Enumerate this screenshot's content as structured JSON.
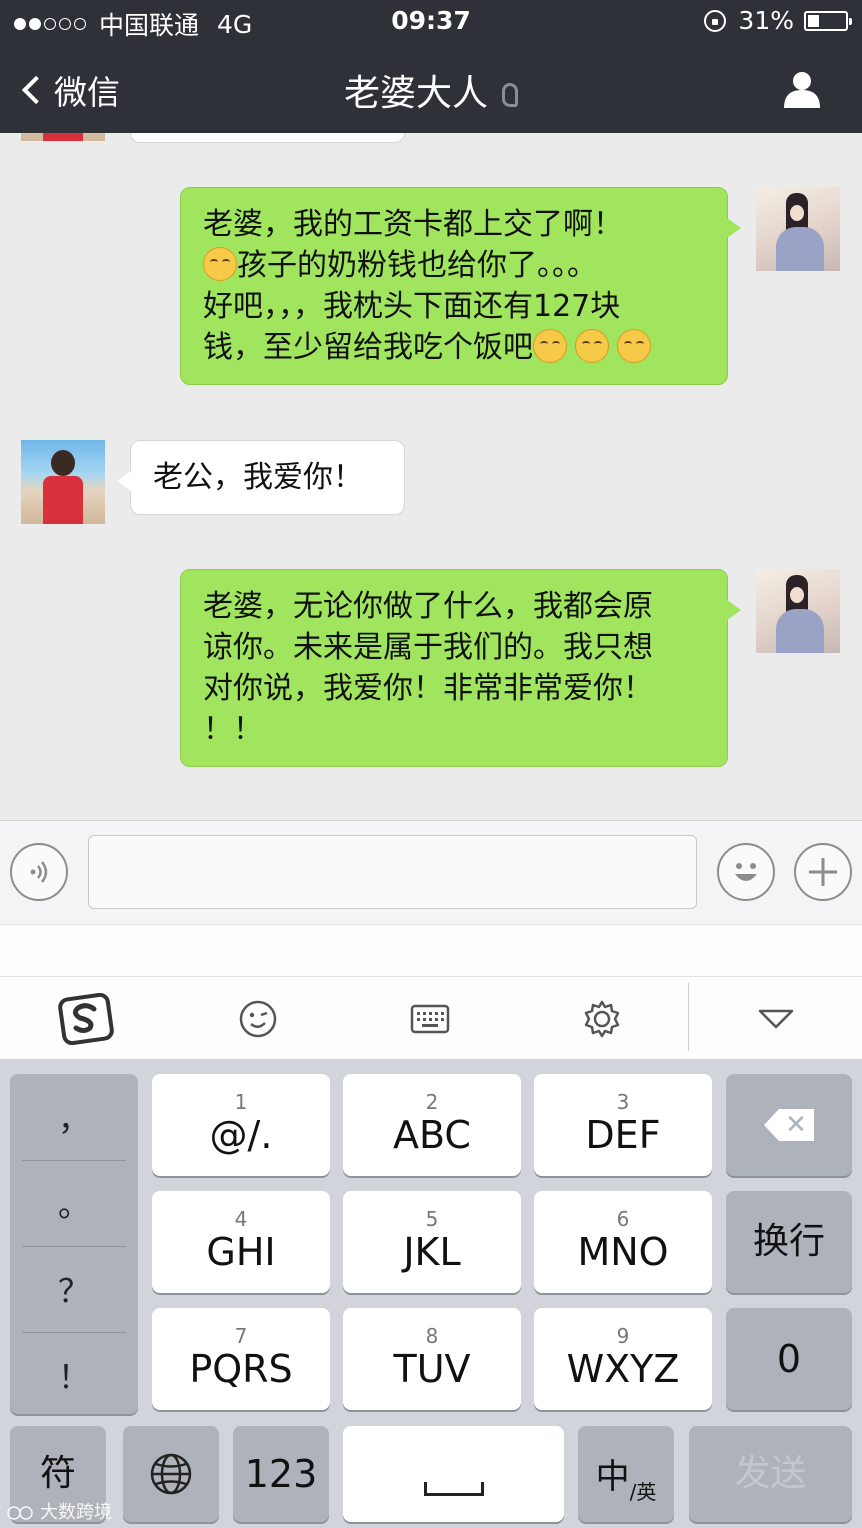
{
  "status_bar": {
    "carrier": "中国联通",
    "network": "4G",
    "time": "09:37",
    "battery": "31%",
    "battery_level": 0.31
  },
  "nav": {
    "back_label": "微信",
    "title": "老婆大人"
  },
  "messages": [
    {
      "side": "right",
      "lines": [
        "老婆，我的工资卡都上交了啊！",
        "孩子的奶粉钱也给你了。。。",
        "好吧，，，我枕头下面还有127块",
        "钱，至少留给我吃个饭吧"
      ]
    },
    {
      "side": "left",
      "lines": [
        "老公，我爱你！"
      ]
    },
    {
      "side": "right",
      "lines": [
        "老婆，无论你做了什么，我都会原",
        "谅你。未来是属于我们的。我只想",
        "对你说，我爱你！非常非常爱你！",
        "！！"
      ]
    }
  ],
  "keyboard": {
    "punct": [
      "，",
      "。",
      "？",
      "！"
    ],
    "keys": [
      {
        "num": "1",
        "letters": "@/."
      },
      {
        "num": "2",
        "letters": "ABC"
      },
      {
        "num": "3",
        "letters": "DEF"
      },
      {
        "num": "4",
        "letters": "GHI"
      },
      {
        "num": "5",
        "letters": "JKL"
      },
      {
        "num": "6",
        "letters": "MNO"
      },
      {
        "num": "7",
        "letters": "PQRS"
      },
      {
        "num": "8",
        "letters": "TUV"
      },
      {
        "num": "9",
        "letters": "WXYZ"
      }
    ],
    "return_label": "换行",
    "zero_label": "0",
    "symbol_label": "符",
    "numeric_label": "123",
    "lang_main": "中",
    "lang_sub": "/英",
    "send_label": "发送"
  },
  "watermark": "大数跨境",
  "colors": {
    "nav_bg": "#2e3238",
    "bubble_sent": "#a0e55d",
    "bubble_received": "#ffffff",
    "chat_bg": "#ebebeb",
    "keyboard_bg": "#d1d5db"
  }
}
